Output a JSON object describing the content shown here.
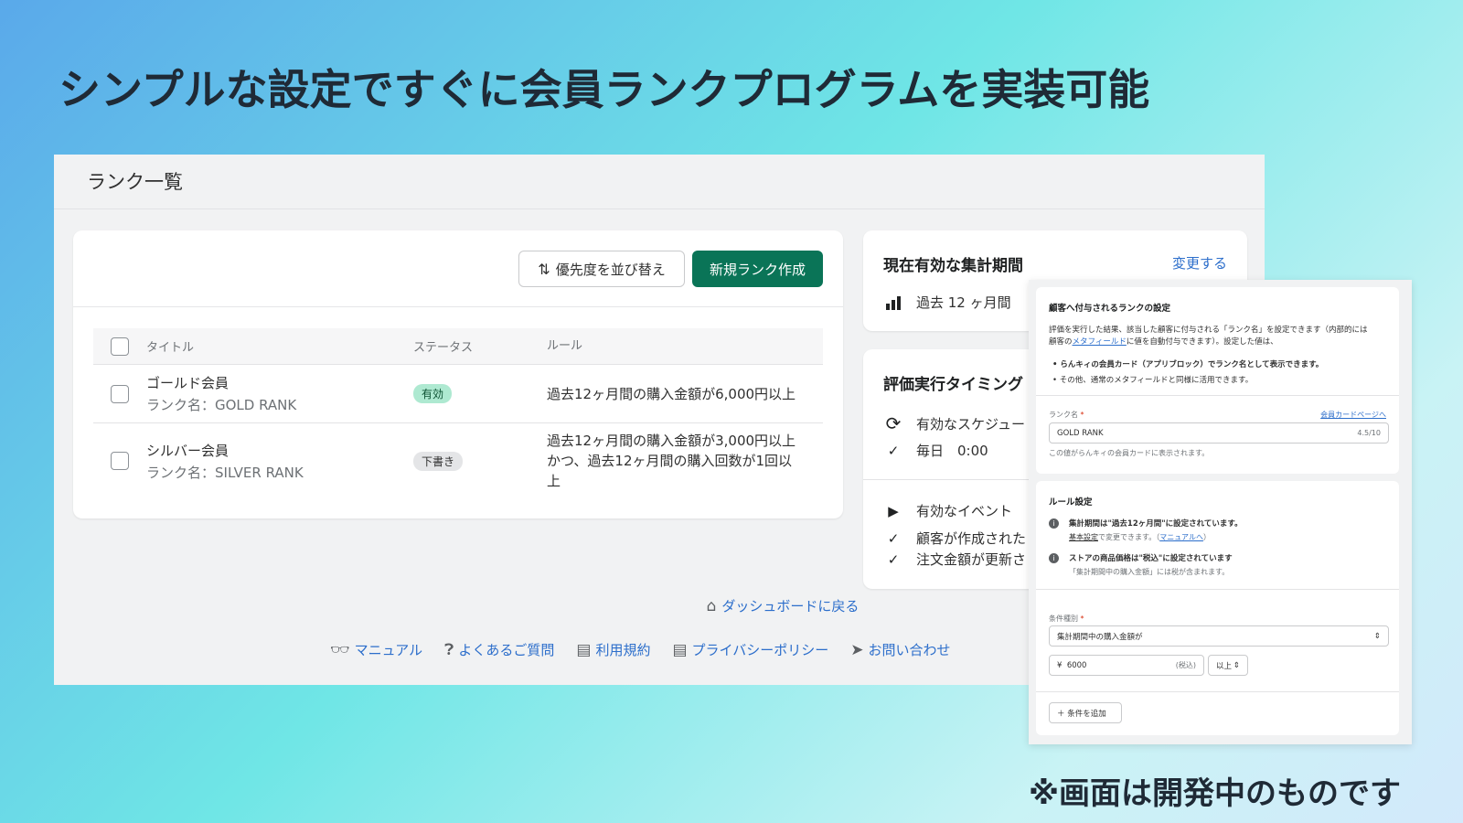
{
  "headline": "シンプルな設定ですぐに会員ランクプログラムを実装可能",
  "footnote": "※画面は開発中のものです",
  "app": {
    "page_title": "ランク一覧",
    "sort_button": "優先度を並び替え",
    "new_button": "新規ランク作成",
    "columns": [
      "タイトル",
      "ステータス",
      "ルール"
    ],
    "ranks": [
      {
        "title": "ゴールド会員",
        "subtitle": "ランク名：GOLD RANK",
        "status": "有効",
        "rule": "過去12ヶ月間の購入金額が6,000円以上"
      },
      {
        "title": "シルバー会員",
        "subtitle": "ランク名：SILVER RANK",
        "status": "下書き",
        "rule": "過去12ヶ月間の購入金額が3,000円以上 かつ、過去12ヶ月間の購入回数が1回以上"
      }
    ],
    "period": {
      "title": "現在有効な集計期間",
      "change_link": "変更する",
      "value": "過去 12 ヶ月間"
    },
    "timing": {
      "title": "評価実行タイミング",
      "schedule_label": "有効なスケジュー",
      "schedule_value": "毎日　0:00",
      "events_label": "有効なイベント",
      "event1": "顧客が作成された",
      "event2": "注文金額が更新さ"
    },
    "footer": {
      "dashboard": "ダッシュボードに戻る",
      "manual": "マニュアル",
      "faq": "よくあるご質問",
      "terms": "利用規約",
      "privacy": "プライバシーポリシー",
      "contact": "お問い合わせ"
    }
  },
  "overlay": {
    "section1_title": "顧客へ付与されるランクの設定",
    "desc1": "評価を実行した結果、該当した顧客に付与される「ランク名」を設定できます（内部的には",
    "desc2_pre": "顧客の",
    "desc2_link": "メタフィールド",
    "desc2_post": "に値を自動付与できます）。設定した値は、",
    "bullet1": "らんキィの会員カード（アプリブロック）でランク名として表示できます。",
    "bullet2": "その他、通常のメタフィールドと同様に活用できます。",
    "rank_name_label": "ランク名",
    "card_page_link": "会員カードページへ",
    "rank_name_value": "GOLD RANK",
    "rank_name_count": "4.5/10",
    "rank_name_help": "この値がらんキィの会員カードに表示されます。",
    "rule_title": "ルール設定",
    "info1_title": "集計期間は\"過去12ヶ月間\"に設定されています。",
    "info1_link": "基本設定",
    "info1_mid": "で変更できます。（",
    "info1_link2": "マニュアルへ",
    "info1_end": "）",
    "info2_title": "ストアの商品価格は\"税込\"に設定されています",
    "info2_text": "「集計期間中の購入金額」には税が含まれます。",
    "cond_label": "条件種別",
    "cond_value": "集計期間中の購入金額が",
    "amount_prefix": "¥",
    "amount_value": "6000",
    "amount_suffix": "(税込)",
    "compare_value": "以上",
    "add_condition": "条件を追加"
  }
}
